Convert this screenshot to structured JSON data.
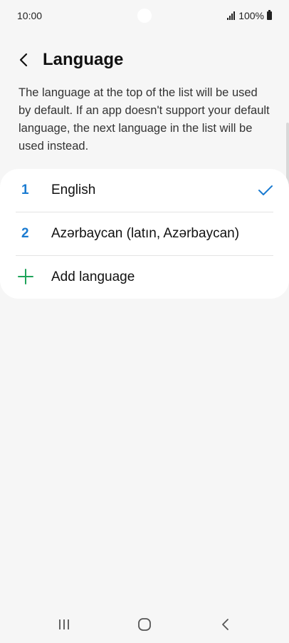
{
  "status_bar": {
    "time": "10:00",
    "battery": "100%"
  },
  "header": {
    "title": "Language",
    "back_icon": "chevron-left-icon"
  },
  "description": "The language at the top of the list will be used by default. If an app doesn't support your default language, the next language in the list will be used instead.",
  "languages": [
    {
      "number": "1",
      "label": "English",
      "selected": true
    },
    {
      "number": "2",
      "label": "Azərbaycan (latın, Azərbaycan)",
      "selected": false
    }
  ],
  "add_language": {
    "label": "Add language",
    "icon": "plus-icon"
  },
  "colors": {
    "accent": "#1a7bd1",
    "add_green": "#1fa45a",
    "background": "#f6f6f6",
    "card": "#ffffff"
  },
  "nav": {
    "recents_icon": "recents-icon",
    "home_icon": "home-icon",
    "back_icon": "back-icon"
  }
}
